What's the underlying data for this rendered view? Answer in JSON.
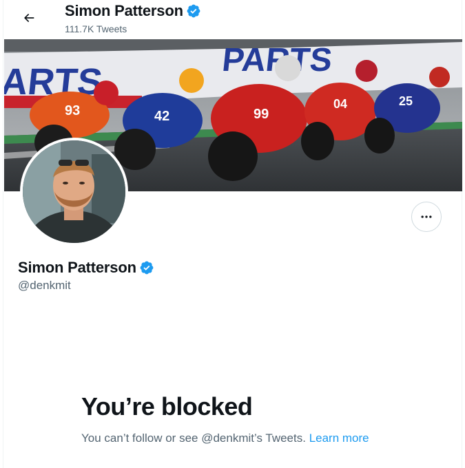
{
  "header": {
    "back_icon": "arrow-left-icon",
    "name": "Simon Patterson",
    "tweet_count": "111.7K Tweets",
    "verified_icon": "verified-badge-icon"
  },
  "banner": {
    "description": "MotoGP motorcycle racing photo",
    "sign_text": "ARTS",
    "sign_text_2": "PARTS",
    "bike_numbers": [
      "93",
      "42",
      "99",
      "04",
      "25"
    ]
  },
  "profile": {
    "name": "Simon Patterson",
    "handle": "@denkmit",
    "more_icon": "more-horizontal-icon"
  },
  "blocked": {
    "title": "You’re blocked",
    "message": "You can’t follow or see @denkmit’s Tweets.",
    "learn_more": "Learn more"
  },
  "colors": {
    "accent": "#1d9bf0",
    "text_primary": "#0f1419",
    "text_secondary": "#536471"
  }
}
